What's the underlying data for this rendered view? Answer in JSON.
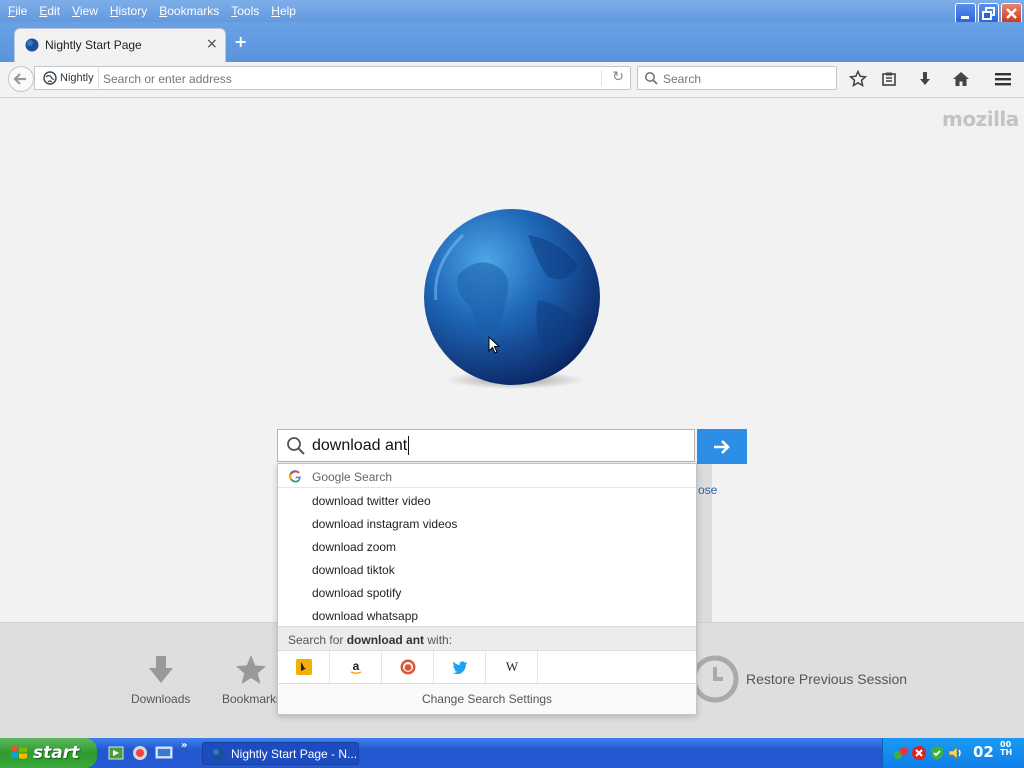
{
  "menu": [
    "File",
    "Edit",
    "View",
    "History",
    "Bookmarks",
    "Tools",
    "Help"
  ],
  "tab": {
    "title": "Nightly Start Page",
    "close": "×",
    "new_tab": "+"
  },
  "navbar": {
    "identity_label": "Nightly",
    "url_placeholder": "Search or enter address",
    "reload": "↻",
    "search_placeholder": "Search"
  },
  "content": {
    "brand": "mozilla",
    "search_value": "download ant",
    "hidden_link": "ose"
  },
  "dropdown": {
    "engine": "Google Search",
    "suggestions": [
      "download twitter video",
      "download instagram videos",
      "download zoom",
      "download tiktok",
      "download spotify",
      "download whatsapp"
    ],
    "search_with_prefix": "Search for ",
    "search_with_term": "download ant",
    "search_with_suffix": " with:",
    "engines": [
      "bing-icon",
      "amazon-icon",
      "duckduckgo-icon",
      "twitter-icon",
      "wikipedia-icon"
    ],
    "change_settings": "Change Search Settings"
  },
  "launcher": {
    "downloads": "Downloads",
    "bookmarks": "Bookmarks",
    "restore": "Restore Previous Session"
  },
  "taskbar": {
    "start": "start",
    "task": "Nightly Start Page - N...",
    "clock": "02",
    "clock_sup_top": "00",
    "clock_sup_bottom": "TH"
  },
  "colors": {
    "accent": "#2d8ee6",
    "taskbar": "#245ad6",
    "start": "#3aa83a"
  }
}
